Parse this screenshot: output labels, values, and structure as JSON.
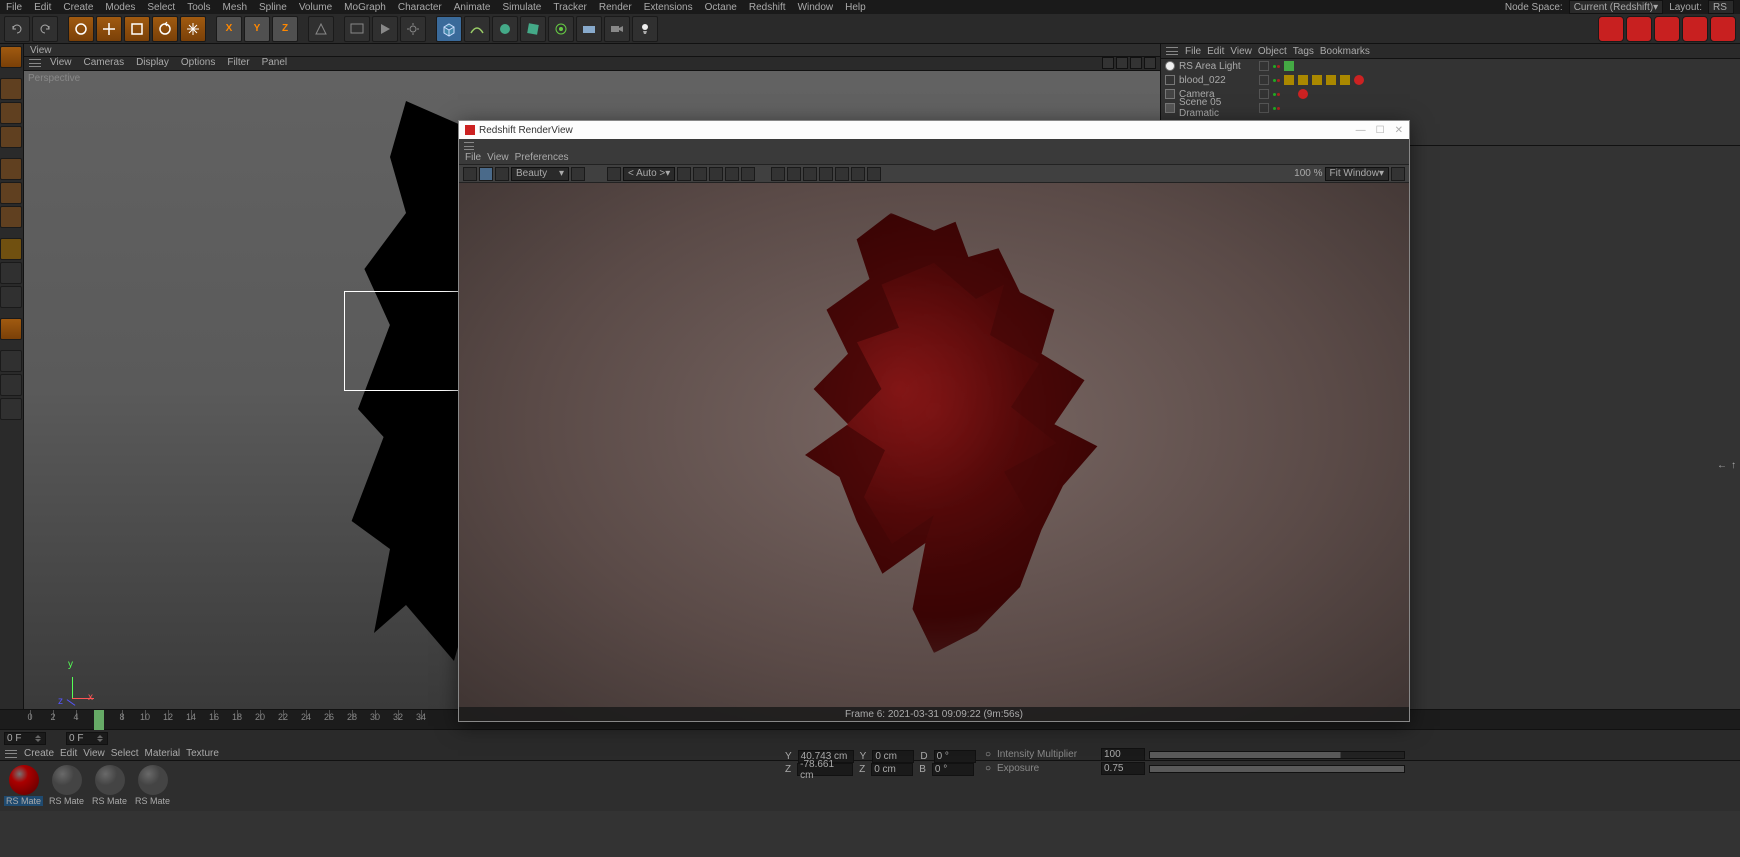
{
  "topmenu": [
    "File",
    "Edit",
    "Create",
    "Modes",
    "Select",
    "Tools",
    "Mesh",
    "Spline",
    "Volume",
    "MoGraph",
    "Character",
    "Animate",
    "Simulate",
    "Tracker",
    "Render",
    "Extensions",
    "Octane",
    "Redshift",
    "Window",
    "Help"
  ],
  "nodespace_label": "Node Space:",
  "nodespace_value": "Current (Redshift)",
  "layout_label": "Layout:",
  "layout_value": "RS",
  "view_tab": "View",
  "view_menu": [
    "View",
    "Cameras",
    "Display",
    "Options",
    "Filter",
    "Panel"
  ],
  "perspective": "Perspective",
  "om_menu": [
    "File",
    "Edit",
    "View",
    "Object",
    "Tags",
    "Bookmarks"
  ],
  "om_items": [
    {
      "name": "RS Area Light",
      "icon": "light"
    },
    {
      "name": "blood_022",
      "icon": "obj"
    },
    {
      "name": "Camera",
      "icon": "cam"
    },
    {
      "name": "Scene 05 Dramatic",
      "icon": "take"
    }
  ],
  "timeline": {
    "frames": [
      "0",
      "2",
      "4",
      "6",
      "8",
      "10",
      "12",
      "14",
      "16",
      "18",
      "20",
      "22",
      "24",
      "26",
      "28",
      "30",
      "32",
      "34"
    ],
    "current": 6,
    "start": "0 F",
    "end": "0 F"
  },
  "mat_menu": [
    "Create",
    "Edit",
    "View",
    "Select",
    "Material",
    "Texture"
  ],
  "materials": [
    {
      "name": "RS Mate",
      "kind": "red",
      "sel": true
    },
    {
      "name": "RS Mate",
      "kind": "dark"
    },
    {
      "name": "RS Mate",
      "kind": "gray"
    },
    {
      "name": "RS Mate",
      "kind": "gray"
    }
  ],
  "renderview": {
    "title": "Redshift RenderView",
    "menu": [
      "File",
      "View",
      "Preferences"
    ],
    "aov": "Beauty",
    "auto": "< Auto >",
    "zoom": "100 %",
    "fit": "Fit Window",
    "status": "Frame  6:   2021-03-31   09:09:22   (9m:56s)"
  },
  "coords": {
    "y_label": "Y",
    "y_val": "40.743 cm",
    "z_label": "Z",
    "z_val": "-78.661 cm",
    "sy_label": "Y",
    "sy_val": "0 cm",
    "sz_label": "Z",
    "sz_val": "0 cm",
    "ry_label": "D",
    "ry_val": "0 °",
    "rz_label": "B",
    "rz_val": "0 °"
  },
  "attr": {
    "p1_label": "Intensity Multiplier",
    "p1_val": "100",
    "p2_label": "Exposure",
    "p2_val": "0.75"
  }
}
